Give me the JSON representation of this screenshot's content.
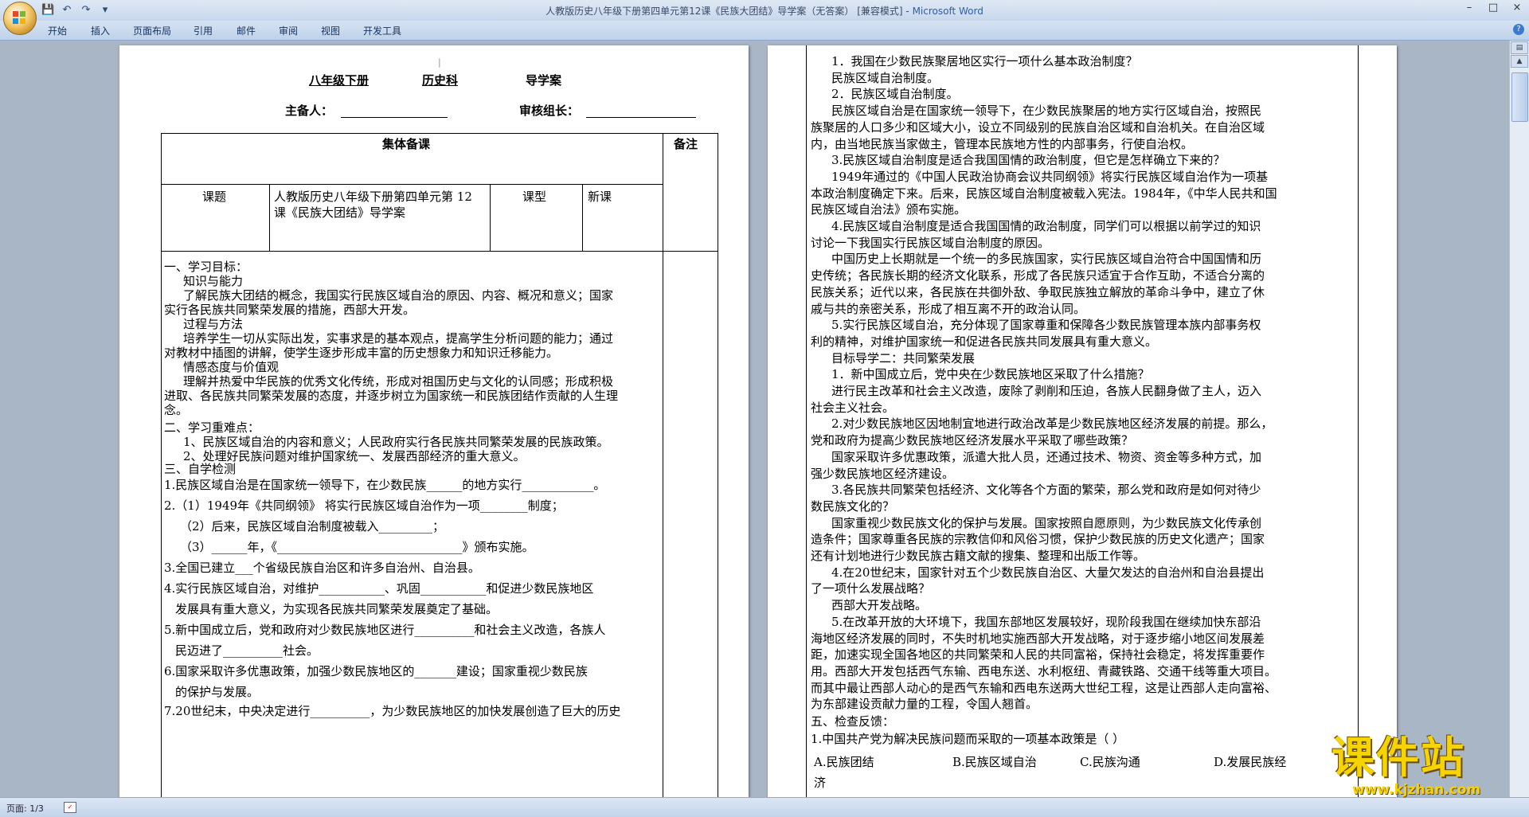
{
  "window": {
    "title": "人教版历史八年级下册第四单元第12课《民族大团结》导学案（无答案） [兼容模式] - ",
    "app": "Microsoft Word"
  },
  "ribbon_tabs": [
    "开始",
    "插入",
    "页面布局",
    "引用",
    "邮件",
    "审阅",
    "视图",
    "开发工具"
  ],
  "status": {
    "page": "页面: 1/3"
  },
  "watermark": {
    "text": "课件站",
    "url": "www.kjzhan.com"
  },
  "page1": {
    "header": "八年级下册",
    "subject": "历史科",
    "doc_type": "导学案",
    "preparer_label": "主备人：",
    "reviewer_label": "审核组长：",
    "table": {
      "collective_prep": "集体备课",
      "remarks": "备注",
      "topic_label": "课题",
      "topic_line1": "人教版历史八年级下册第四单元第 12",
      "topic_line2": "课《民族大团结》导学案",
      "lesson_type_label": "课型",
      "lesson_type": "新课"
    },
    "lines": [
      "一、学习目标：",
      "知识与能力",
      "了解民族大团结的概念，我国实行民族区域自治的原因、内容、概况和意义；国家",
      "实行各民族共同繁荣发展的措施，西部大开发。",
      "过程与方法",
      "培养学生一切从实际出发，实事求是的基本观点，提高学生分析问题的能力；通过",
      "对教材中插图的讲解，使学生逐步形成丰富的历史想象力和知识迁移能力。",
      "情感态度与价值观",
      "理解并热爱中华民族的优秀文化传统，形成对祖国历史与文化的认同感；形成积极",
      "进取、各民族共同繁荣发展的态度，并逐步树立为国家统一和民族团结作贡献的人生理",
      "念。",
      "二、学习重难点：",
      "1、民族区域自治的内容和意义；人民政府实行各民族共同繁荣发展的民族政策。",
      "2、处理好民族问题对维护国家统一、发展西部经济的重大意义。",
      "三、自学检测",
      "1.民族区域自治是在国家统一领导下，在少数民族______的地方实行____________。",
      "2.（1）1949年《共同纲领》 将实行民族区域自治作为一项________制度；",
      "（2）后来，民族区域自治制度被载入_________；",
      "（3）______年，《_______________________________》颁布实施。",
      "3.全国已建立___个省级民族自治区和许多自治州、自治县。",
      "4.实行民族区域自治，对维护___________、巩固___________和促进少数民族地区",
      "发展具有重大意义，为实现各民族共同繁荣发展奠定了基础。",
      "5.新中国成立后，党和政府对少数民族地区进行__________和社会主义改造，各族人",
      "民迈进了__________社会。",
      "6.国家采取许多优惠政策，加强少数民族地区的_______建设；国家重视少数民族",
      "的保护与发展。",
      "7.20世纪末，中央决定进行__________，为少数民族地区的加快发展创造了巨大的历史"
    ]
  },
  "page2": {
    "lines": [
      "1．我国在少数民族聚居地区实行一项什么基本政治制度？",
      "民族区域自治制度。",
      "2．民族区域自治制度。",
      "民族区域自治是在国家统一领导下，在少数民族聚居的地方实行区域自治，按照民",
      "族聚居的人口多少和区域大小，设立不同级别的民族自治区域和自治机关。在自治区域",
      "内，由当地民族当家做主，管理本民族地方性的内部事务，行使自治权。",
      "3.民族区域自治制度是适合我国国情的政治制度，但它是怎样确立下来的？",
      "1949年通过的《中国人民政治协商会议共同纲领》将实行民族区域自治作为一项基",
      "本政治制度确定下来。后来，民族区域自治制度被载入宪法。1984年，《中华人民共和国",
      "民族区域自治法》颁布实施。",
      "4.民族区域自治制度是适合我国国情的政治制度，同学们可以根据以前学过的知识",
      "讨论一下我国实行民族区域自治制度的原因。",
      "中国历史上长期就是一个统一的多民族国家，实行民族区域自治符合中国国情和历",
      "史传统；各民族长期的经济文化联系，形成了各民族只适宜于合作互助，不适合分离的",
      "民族关系；近代以来，各民族在共御外敌、争取民族独立解放的革命斗争中，建立了休",
      "戚与共的亲密关系，形成了相互离不开的政治认同。",
      "5.实行民族区域自治，充分体现了国家尊重和保障各少数民族管理本族内部事务权",
      "利的精神，对维护国家统一和促进各民族共同发展具有重大意义。",
      "目标导学二：共同繁荣发展",
      "1．新中国成立后，党中央在少数民族地区采取了什么措施？",
      "进行民主改革和社会主义改造，废除了剥削和压迫，各族人民翻身做了主人，迈入",
      "社会主义社会。",
      "2.对少数民族地区因地制宜地进行政治改革是少数民族地区经济发展的前提。那么，",
      "党和政府为提高少数民族地区经济发展水平采取了哪些政策？",
      "国家采取许多优惠政策，派遣大批人员，还通过技术、物资、资金等多种方式，加",
      "强少数民族地区经济建设。",
      "3.各民族共同繁荣包括经济、文化等各个方面的繁荣，那么党和政府是如何对待少",
      "数民族文化的？",
      "国家重视少数民族文化的保护与发展。国家按照自愿原则，为少数民族文化传承创",
      "造条件；国家尊重各民族的宗教信仰和风俗习惯，保护少数民族的历史文化遗产；国家",
      "还有计划地进行少数民族古籍文献的搜集、整理和出版工作等。",
      "4.在20世纪末，国家针对五个少数民族自治区、大量欠发达的自治州和自治县提出",
      "了一项什么发展战略？",
      "西部大开发战略。",
      "5.在改革开放的大环境下，我国东部地区发展较好，现阶段我国在继续加快东部沿",
      "海地区经济发展的同时，不失时机地实施西部大开发战略，对于逐步缩小地区间发展差",
      "距，加速实现全国各地区的共同繁荣和人民的共同富裕，保持社会稳定，将发挥重要作",
      "用。西部大开发包括西气东输、西电东送、水利枢纽、青藏铁路、交通干线等重大项目。",
      "而其中最让西部人动心的是西气东输和西电东送两大世纪工程，这是让西部人走向富裕、",
      "为东部建设贡献力量的工程，令国人翘首。",
      "五、检查反馈：",
      "1.中国共产党为解决民族问题而采取的一项基本政策是（      ）"
    ],
    "options": [
      "A.民族团结",
      "B.民族区域自治",
      "C.民族沟通",
      "D.发展民族经"
    ],
    "overflow": "济"
  }
}
